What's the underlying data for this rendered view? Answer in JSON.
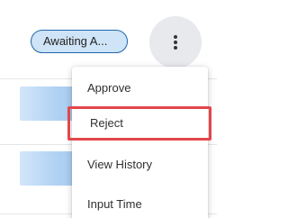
{
  "row": {
    "status_chip": "Awaiting A...",
    "actions_icon": "more-vertical-icon"
  },
  "menu": {
    "items": [
      {
        "label": "Approve"
      },
      {
        "label": "Reject"
      },
      {
        "label": "View History"
      },
      {
        "label": "Input Time"
      }
    ],
    "highlighted_item": "Reject"
  },
  "colors": {
    "chip_bg": "#cfe4f6",
    "chip_border": "#1f67b1",
    "highlight_border": "#e2474b"
  }
}
